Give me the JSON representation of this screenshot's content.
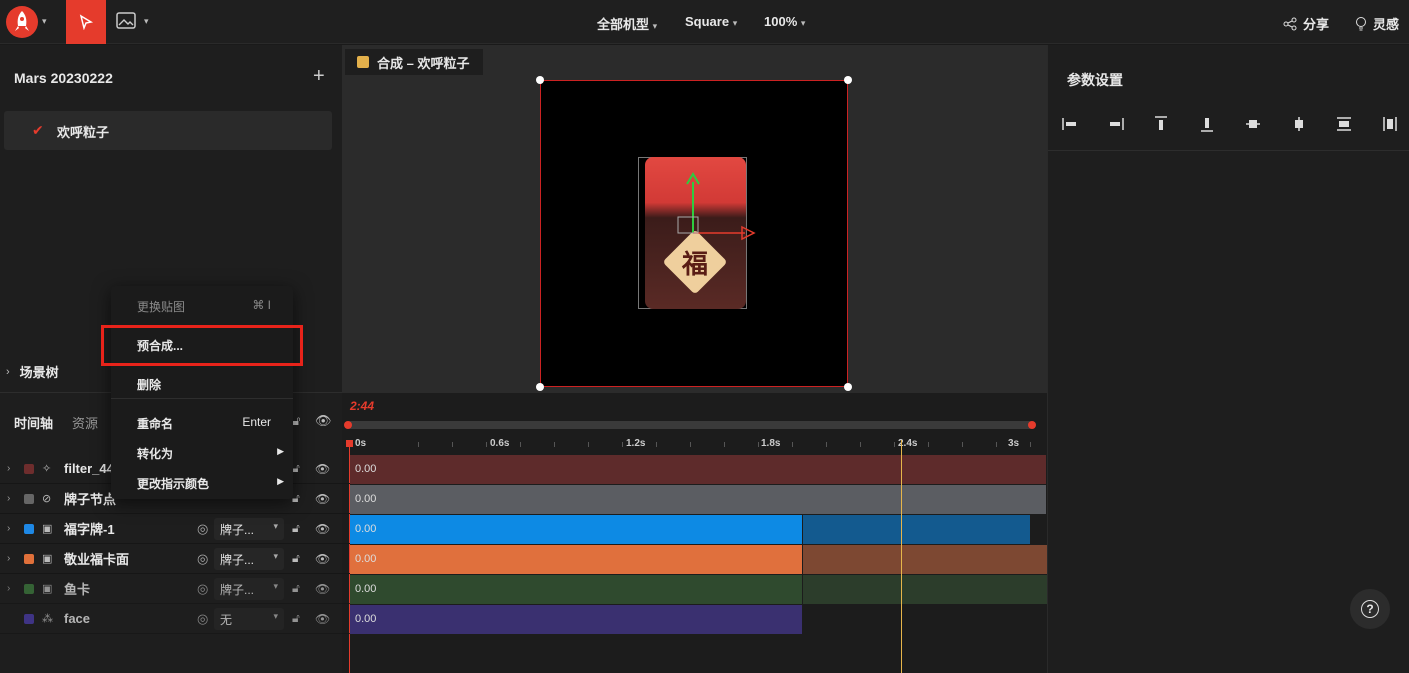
{
  "topbar": {
    "view_select": "全部机型",
    "aspect_select": "Square",
    "zoom": "100%",
    "share_label": "分享",
    "inspire_label": "灵感"
  },
  "left_panel": {
    "project_title": "Mars 20230222",
    "add_label": "+",
    "compositions": [
      {
        "label": "欢呼粒子",
        "selected": true
      }
    ],
    "scene_tree_label": "场景树"
  },
  "canvas": {
    "tab_label": "合成 – 欢呼粒子",
    "card_char": "福"
  },
  "timeline": {
    "tabs": [
      "时间轴",
      "资源"
    ],
    "current_time": "2:44",
    "ticks": [
      "0s",
      "0.6s",
      "1.2s",
      "1.8s",
      "2.4s",
      "3s"
    ],
    "rows": [
      {
        "name": "filter_44",
        "color": "#6e2d2d",
        "icon": "sparkle-icon",
        "select": "",
        "value": "0.00",
        "bar_color": "#5e2b2b",
        "bar_end": 1.0,
        "tail_color": "",
        "dim": false
      },
      {
        "name": "牌子节点",
        "color": "#666666",
        "icon": "null-node-icon",
        "select": "",
        "value": "0.00",
        "bar_color": "#5b5d62",
        "bar_end": 1.0,
        "tail_color": "",
        "dim": false
      },
      {
        "name": "福字牌-1",
        "color": "#1e88e5",
        "icon": "image-icon",
        "select": "牌子...",
        "value": "0.00",
        "bar_color": "#0d8ae4",
        "bar_end": 0.65,
        "tail_color": "#135a8f",
        "dim": false
      },
      {
        "name": "敬业福卡面",
        "color": "#e0703a",
        "icon": "image-icon",
        "select": "牌子...",
        "value": "0.00",
        "bar_color": "#e0703d",
        "bar_end": 0.65,
        "tail_color": "#7d4832",
        "dim": false
      },
      {
        "name": "鱼卡",
        "color": "#3d7a3d",
        "icon": "image-icon",
        "select": "牌子...",
        "value": "0.00",
        "bar_color": "#2f4a2e",
        "bar_end": 0.65,
        "tail_color": "#2c3d2b",
        "dim": true
      },
      {
        "name": "face",
        "color": "#4a3ca8",
        "icon": "particle-icon",
        "select": "无",
        "value": "0.00",
        "bar_color": "#3a3070",
        "bar_end": 0.65,
        "tail_color": "",
        "dim": true
      }
    ]
  },
  "context_menu": {
    "items": [
      {
        "label": "更换贴图",
        "shortcut": "⌘ I",
        "disabled": true,
        "submenu": false
      },
      {
        "label": "预合成...",
        "shortcut": "",
        "disabled": false,
        "submenu": false,
        "highlighted": true
      },
      {
        "label": "删除",
        "shortcut": "",
        "disabled": false,
        "submenu": false
      },
      {
        "label": "重命名",
        "shortcut": "Enter",
        "disabled": false,
        "submenu": false
      },
      {
        "label": "转化为",
        "shortcut": "",
        "disabled": false,
        "submenu": true
      },
      {
        "label": "更改指示颜色",
        "shortcut": "",
        "disabled": false,
        "submenu": true
      }
    ]
  },
  "right_panel": {
    "title": "参数设置",
    "align_icons": [
      "align-left-icon",
      "align-hcenter-icon",
      "align-top-icon",
      "align-bottom-icon",
      "align-vcenter-icon",
      "align-middle-icon",
      "distribute-vertical-icon",
      "distribute-horizontal-icon"
    ]
  },
  "help_label": "?"
}
